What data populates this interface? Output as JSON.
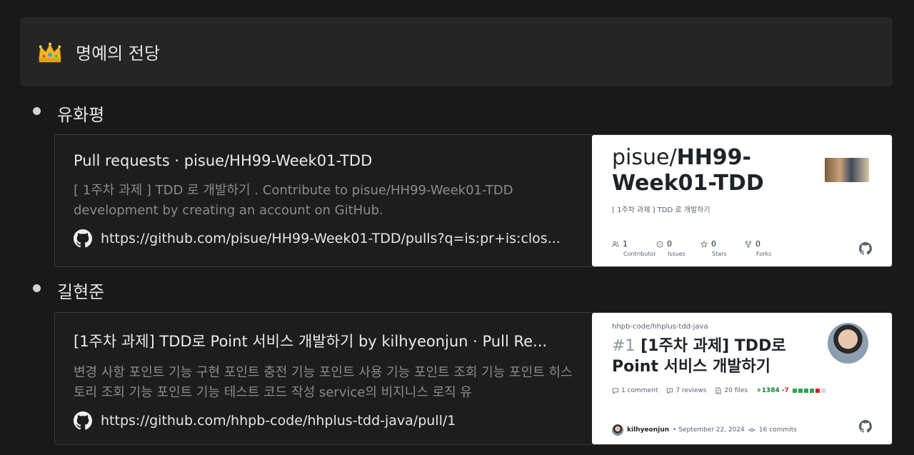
{
  "callout": {
    "icon": "crown-emoji-icon",
    "title": "명예의 전당"
  },
  "entries": [
    {
      "name": "유화평",
      "bookmark": {
        "title": "Pull requests · pisue/HH99-Week01-TDD",
        "description": "[ 1주차 과제 ] TDD 로 개발하기 . Contribute to pisue/HH99-Week01-TDD development by creating an account on GitHub.",
        "url": "https://github.com/pisue/HH99-Week01-TDD/pulls?q=is:pr+is:clos...",
        "card": {
          "owner": "pisue/",
          "repo": "HH99-Week01-TDD",
          "desc": "[ 1주차 과제 ] TDD 로 개발하기",
          "stats": [
            {
              "icon": "people-icon",
              "count": "1",
              "label": "Contributor"
            },
            {
              "icon": "issue-icon",
              "count": "0",
              "label": "Issues"
            },
            {
              "icon": "star-icon",
              "count": "0",
              "label": "Stars"
            },
            {
              "icon": "fork-icon",
              "count": "0",
              "label": "Forks"
            }
          ]
        }
      }
    },
    {
      "name": "길현준",
      "bookmark": {
        "title": "[1주차 과제] TDD로 Point 서비스 개발하기 by kilhyeonjun · Pull Re...",
        "description": "변경 사항   포인트 기능 구현  포인트 충전 기능 포인트 사용 기능 포인트 조회 기능 포인트 히스토리 조회 기능    포인트 기능 테스트 코드 작성  service의 비지니스 로직 유",
        "url": "https://github.com/hhpb-code/hhplus-tdd-java/pull/1",
        "card": {
          "repo_path": "hhpb-code/hhplus-tdd-java",
          "number": "#1",
          "title": "[1주차 과제] TDD로 Point 서비스 개발하기",
          "comments": "1 comment",
          "reviews": "7 reviews",
          "files": "20 files",
          "additions": "+1384",
          "deletions": "-7",
          "author": "kilhyeonjun",
          "date": "• September 22, 2024",
          "commits": "16 commits"
        }
      }
    }
  ],
  "colors": {
    "diff_green": "#2da44e",
    "diff_red": "#cf222e",
    "diff_gray": "#d0d7de"
  }
}
